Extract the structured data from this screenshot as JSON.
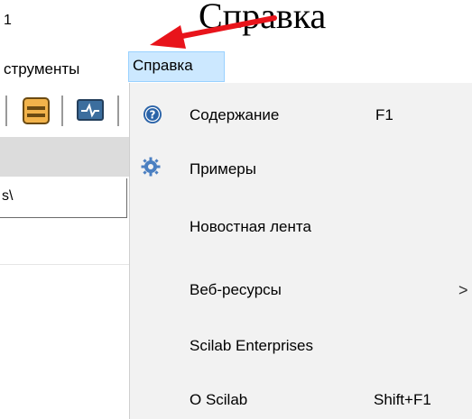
{
  "annotation": {
    "title": "Справка",
    "arrow_color": "#e8141b"
  },
  "window": {
    "title_fragment": "1"
  },
  "menubar": {
    "tools_label": "струменты",
    "help_label": "Справка"
  },
  "toolbar": {
    "buttons": [
      {
        "icon": "folder-icon"
      },
      {
        "icon": "monitor-icon"
      }
    ]
  },
  "path_field": {
    "value": "s\\"
  },
  "help_menu": {
    "items": [
      {
        "label": "Содержание",
        "shortcut": "F1",
        "icon": "help-question-icon",
        "submenu": false
      },
      {
        "label": "Примеры",
        "shortcut": "",
        "icon": "gear-icon",
        "submenu": false
      },
      {
        "label": "Новостная лента",
        "shortcut": "",
        "icon": "",
        "submenu": false
      },
      {
        "label": "Веб-ресурсы",
        "shortcut": "",
        "icon": "",
        "submenu": true,
        "submenu_arrow": ">"
      },
      {
        "label": "Scilab Enterprises",
        "shortcut": "",
        "icon": "",
        "submenu": false
      },
      {
        "label": "O Scilab",
        "shortcut": "Shift+F1",
        "icon": "",
        "submenu": false
      }
    ]
  }
}
